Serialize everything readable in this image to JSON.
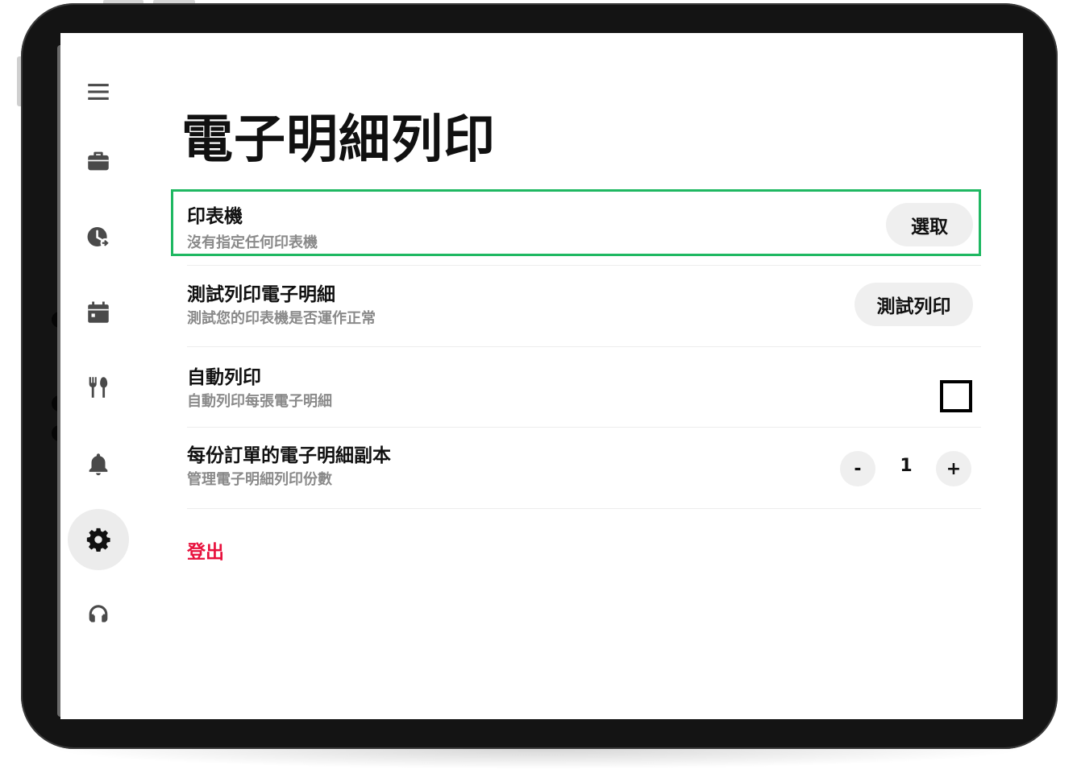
{
  "page": {
    "title": "電子明細列印"
  },
  "sidebar": {
    "items": [
      {
        "icon": "menu-icon",
        "active": false
      },
      {
        "icon": "briefcase-icon",
        "active": false
      },
      {
        "icon": "clock-history-icon",
        "active": false
      },
      {
        "icon": "calendar-icon",
        "active": false
      },
      {
        "icon": "restaurant-icon",
        "active": false
      },
      {
        "icon": "bell-icon",
        "active": false
      },
      {
        "icon": "gear-icon",
        "active": true
      },
      {
        "icon": "headset-icon",
        "active": false
      }
    ]
  },
  "settings": {
    "printer": {
      "title": "印表機",
      "subtitle": "沒有指定任何印表機",
      "button_label": "選取"
    },
    "test_print": {
      "title": "測試列印電子明細",
      "subtitle": "測試您的印表機是否運作正常",
      "button_label": "測試列印"
    },
    "auto_print": {
      "title": "自動列印",
      "subtitle": "自動列印每張電子明細",
      "checked": false
    },
    "copies": {
      "title": "每份訂單的電子明細副本",
      "subtitle": "管理電子明細列印份數",
      "decrement_label": "-",
      "value": "1",
      "increment_label": "+"
    }
  },
  "logout": {
    "label": "登出",
    "color": "#e8113d"
  },
  "colors": {
    "highlight": "#1fb862",
    "device_frame": "#141414",
    "button_bg": "#efefef"
  }
}
